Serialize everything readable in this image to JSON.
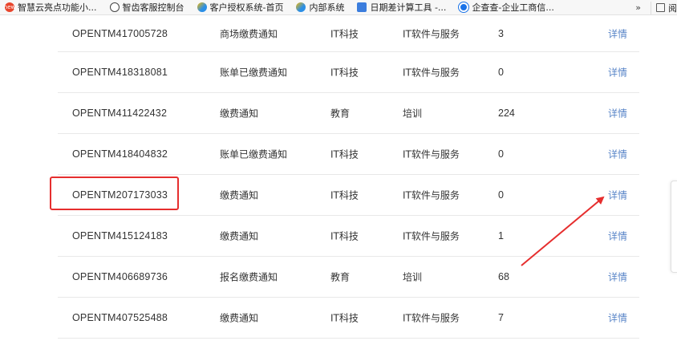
{
  "bookmarks": [
    {
      "label": "智慧云亮点功能小...",
      "icon": "new-badge-icon"
    },
    {
      "label": "智齿客服控制台",
      "icon": "globe-icon"
    },
    {
      "label": "客户授权系统-首页",
      "icon": "browser-e-icon"
    },
    {
      "label": "内部系统",
      "icon": "browser-e-icon"
    },
    {
      "label": "日期差计算工具 -...",
      "icon": "calendar-icon"
    },
    {
      "label": "企查查-企业工商信...",
      "icon": "qcc-icon"
    }
  ],
  "bookmark_bar": {
    "more_label": "»",
    "reading_label": "阅"
  },
  "rows": [
    {
      "id": "OPENTM417005728",
      "title": "商场缴费通知",
      "industry1": "IT科技",
      "industry2": "IT软件与服务",
      "count": "3",
      "action": "详情"
    },
    {
      "id": "OPENTM418318081",
      "title": "账单已缴费通知",
      "industry1": "IT科技",
      "industry2": "IT软件与服务",
      "count": "0",
      "action": "详情"
    },
    {
      "id": "OPENTM411422432",
      "title": "缴费通知",
      "industry1": "教育",
      "industry2": "培训",
      "count": "224",
      "action": "详情"
    },
    {
      "id": "OPENTM418404832",
      "title": "账单已缴费通知",
      "industry1": "IT科技",
      "industry2": "IT软件与服务",
      "count": "0",
      "action": "详情"
    },
    {
      "id": "OPENTM207173033",
      "title": "缴费通知",
      "industry1": "IT科技",
      "industry2": "IT软件与服务",
      "count": "0",
      "action": "详情"
    },
    {
      "id": "OPENTM415124183",
      "title": "缴费通知",
      "industry1": "IT科技",
      "industry2": "IT软件与服务",
      "count": "1",
      "action": "详情"
    },
    {
      "id": "OPENTM406689736",
      "title": "报名缴费通知",
      "industry1": "教育",
      "industry2": "培训",
      "count": "68",
      "action": "详情"
    },
    {
      "id": "OPENTM407525488",
      "title": "缴费通知",
      "industry1": "IT科技",
      "industry2": "IT软件与服务",
      "count": "7",
      "action": "详情"
    }
  ],
  "annotation": {
    "color": "#e62e2e",
    "highlighted_row": 4
  }
}
